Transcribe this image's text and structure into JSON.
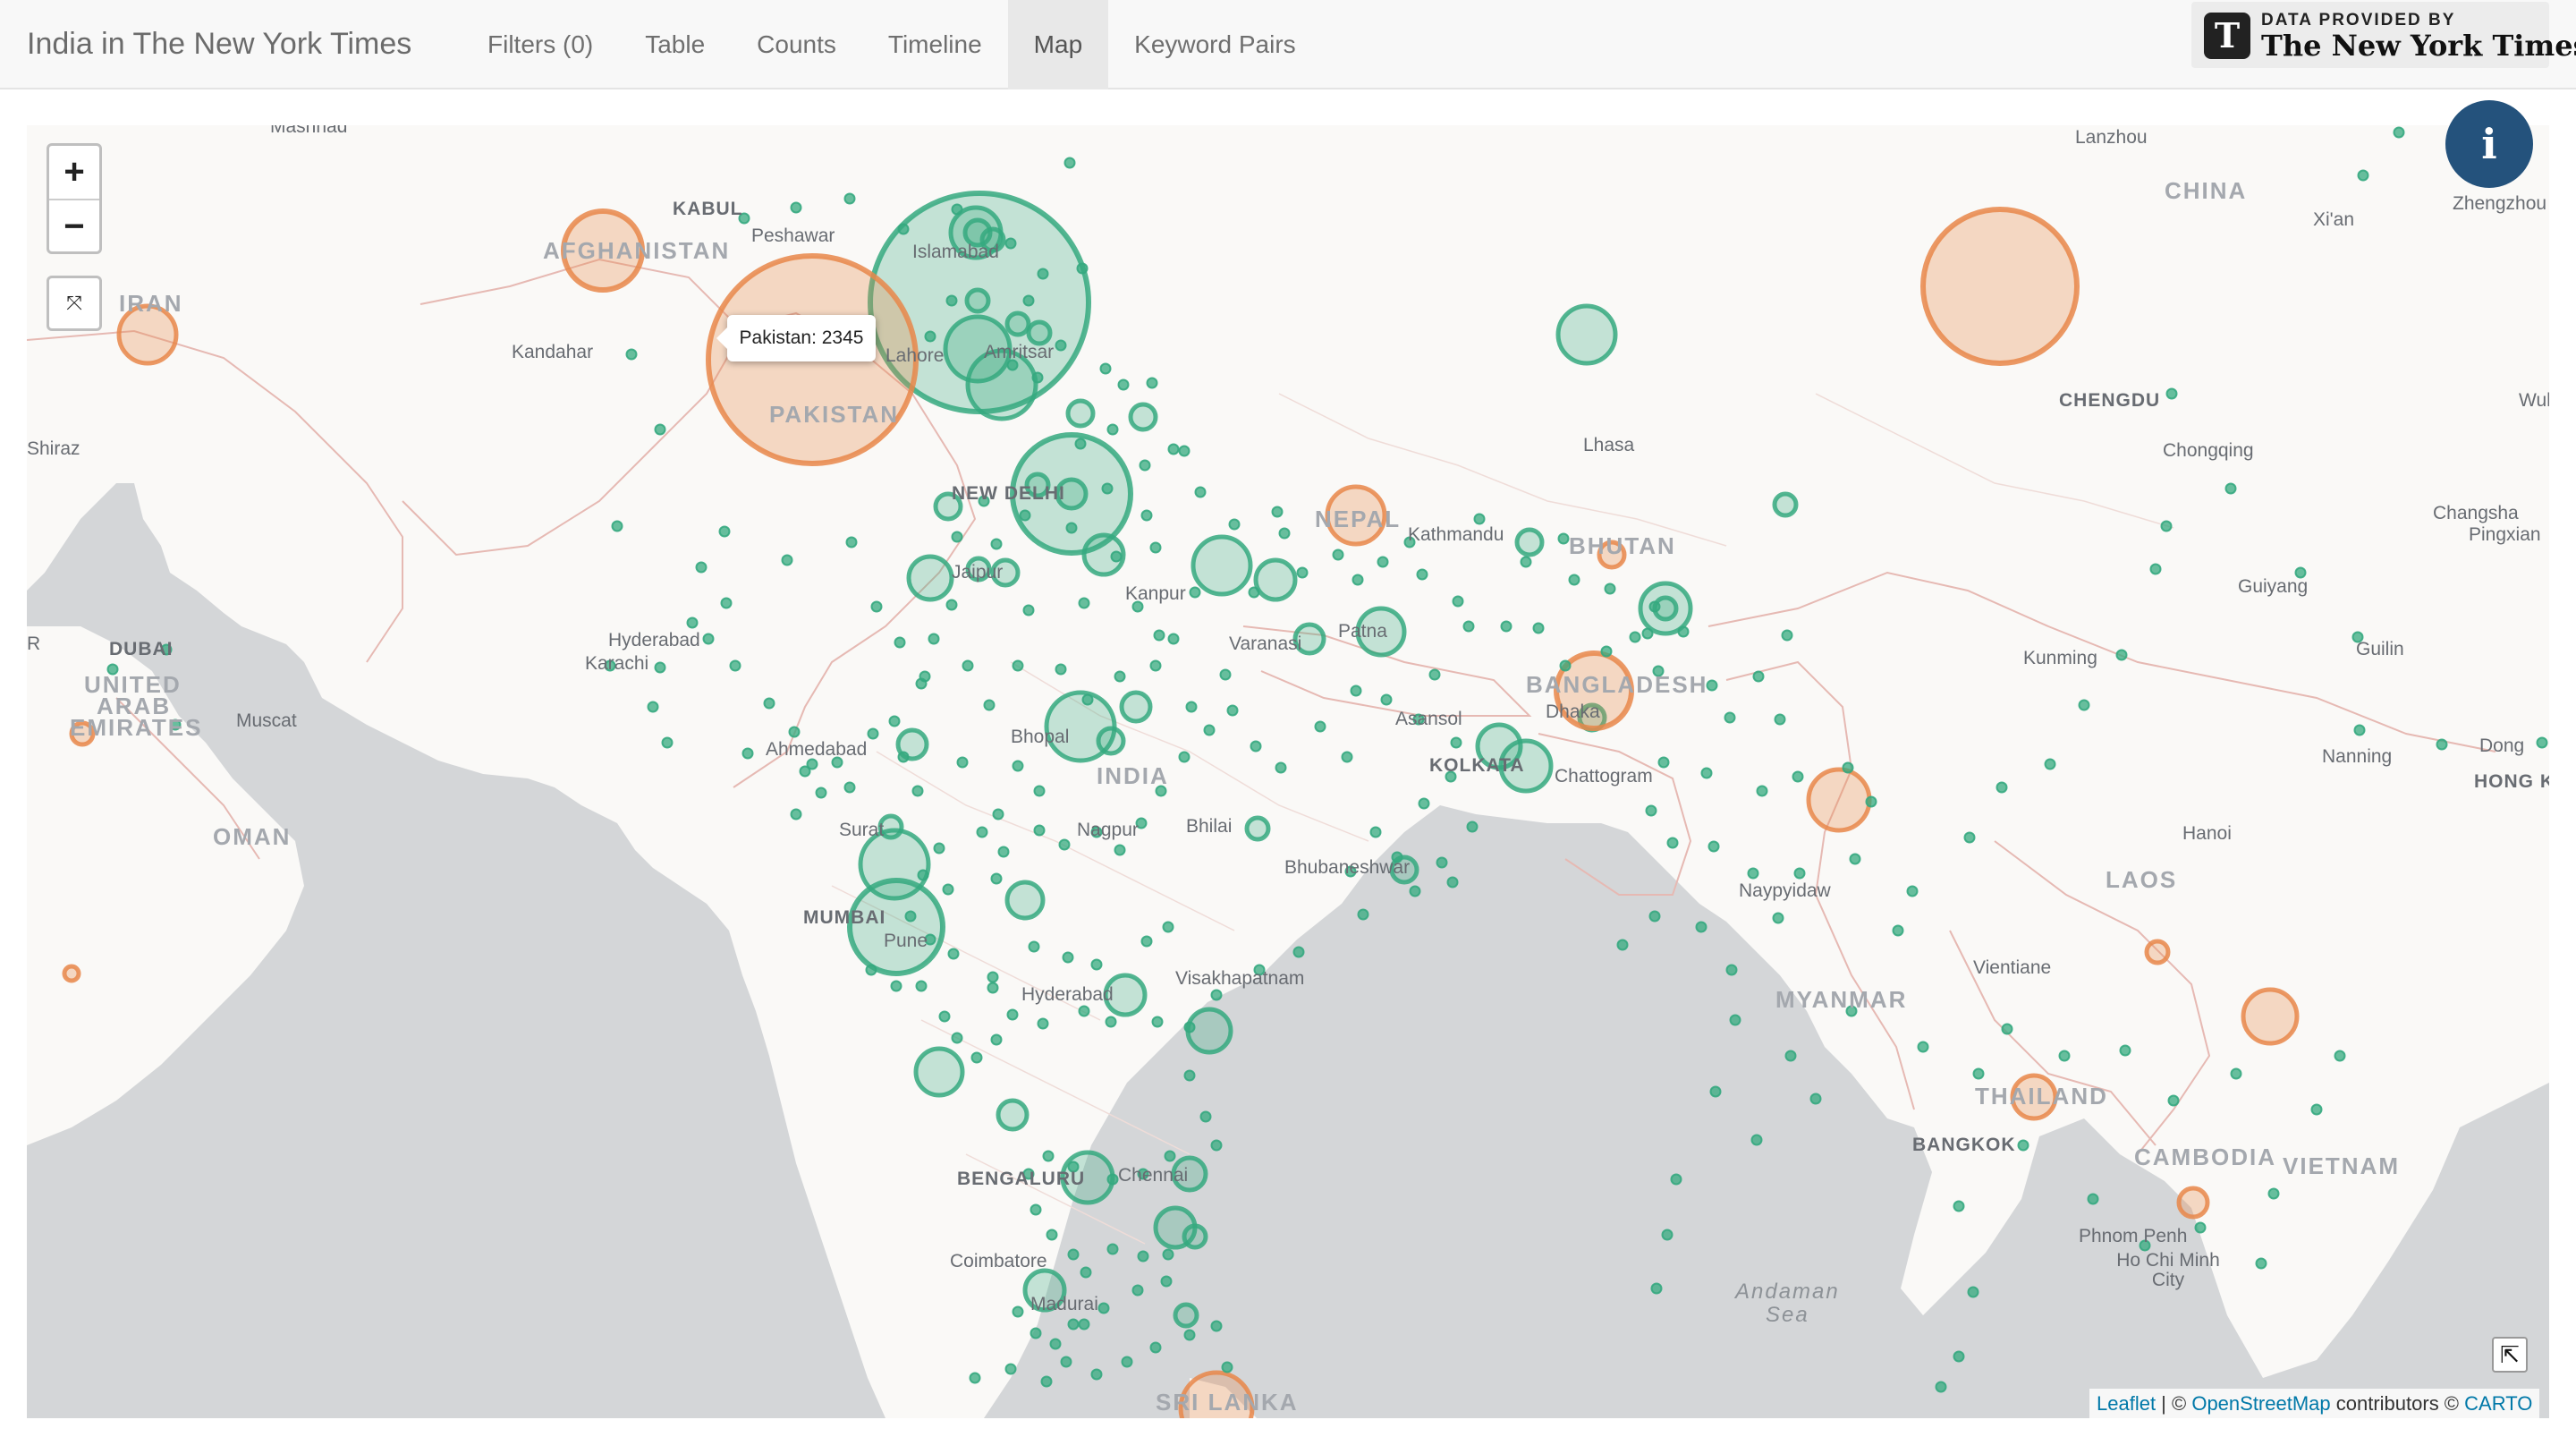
{
  "navbar": {
    "brand": "India in The New York Times",
    "tabs": [
      {
        "label": "Filters (0)",
        "active": false
      },
      {
        "label": "Table",
        "active": false
      },
      {
        "label": "Counts",
        "active": false
      },
      {
        "label": "Timeline",
        "active": false
      },
      {
        "label": "Map",
        "active": true
      },
      {
        "label": "Keyword Pairs",
        "active": false
      }
    ],
    "nyt_badge": {
      "top_line": "DATA PROVIDED BY",
      "name": "The New York Times",
      "icon": "nyt-t-logo"
    }
  },
  "map": {
    "zoom_in": "+",
    "zoom_out": "−",
    "reset_view": "⤧",
    "info_button": "i",
    "expand_button": "⇱",
    "tooltip": "Pakistan: 2345",
    "attribution": {
      "leaflet": "Leaflet",
      "sep": " | © ",
      "osm": "OpenStreetMap",
      "mid": " contributors © ",
      "carto": "CARTO"
    },
    "colors": {
      "india_markers": "#35a97f",
      "other_country_markers": "#e8874a",
      "land": "#faf9f7",
      "water": "#d4d6d8"
    },
    "labels": {
      "countries": [
        "AFGHANISTAN",
        "IRAN",
        "PAKISTAN",
        "NEPAL",
        "BHUTAN",
        "BANGLADESH",
        "INDIA",
        "MYANMAR",
        "CHINA",
        "LAOS",
        "THAILAND",
        "CAMBODIA",
        "VIETNAM",
        "OMAN",
        "UNITED",
        "ARAB",
        "EMIRATES",
        "SRI LANKA"
      ],
      "cities": [
        "Mashhad",
        "KABUL",
        "Peshawar",
        "Islamabad",
        "Kandahar",
        "Lahore",
        "Amritsar",
        "NEW DELHI",
        "Jaipur",
        "Kanpur",
        "Kathmandu",
        "Lhasa",
        "Lanzhou",
        "Xi'an",
        "Zhengzhou",
        "CHENGDU",
        "Chongqing",
        "Changsha",
        "Pingxian",
        "Wuh",
        "Guiyang",
        "Kunming",
        "Guilin",
        "Nanning",
        "Dong",
        "HONG KO",
        "Hanoi",
        "Naypyidaw",
        "Vientiane",
        "BANGKOK",
        "Phnom Penh",
        "Ho Chi Minh City",
        "Patna",
        "Varanasi",
        "Asansol",
        "KOLKATA",
        "Dhaka",
        "Chattogram",
        "Bhopal",
        "Ahmedabad",
        "Surat",
        "MUMBAI",
        "Pune",
        "Nagpur",
        "Bhilai",
        "Bhubaneshwar",
        "Hyderabad",
        "Visakhapatnam",
        "BENGALURU",
        "Chennai",
        "Coimbatore",
        "Madurai",
        "Hyderabad",
        "Karachi",
        "DUBAI",
        "Muscat",
        "Shiraz",
        "R"
      ],
      "water": [
        "Andaman",
        "Sea"
      ]
    }
  }
}
